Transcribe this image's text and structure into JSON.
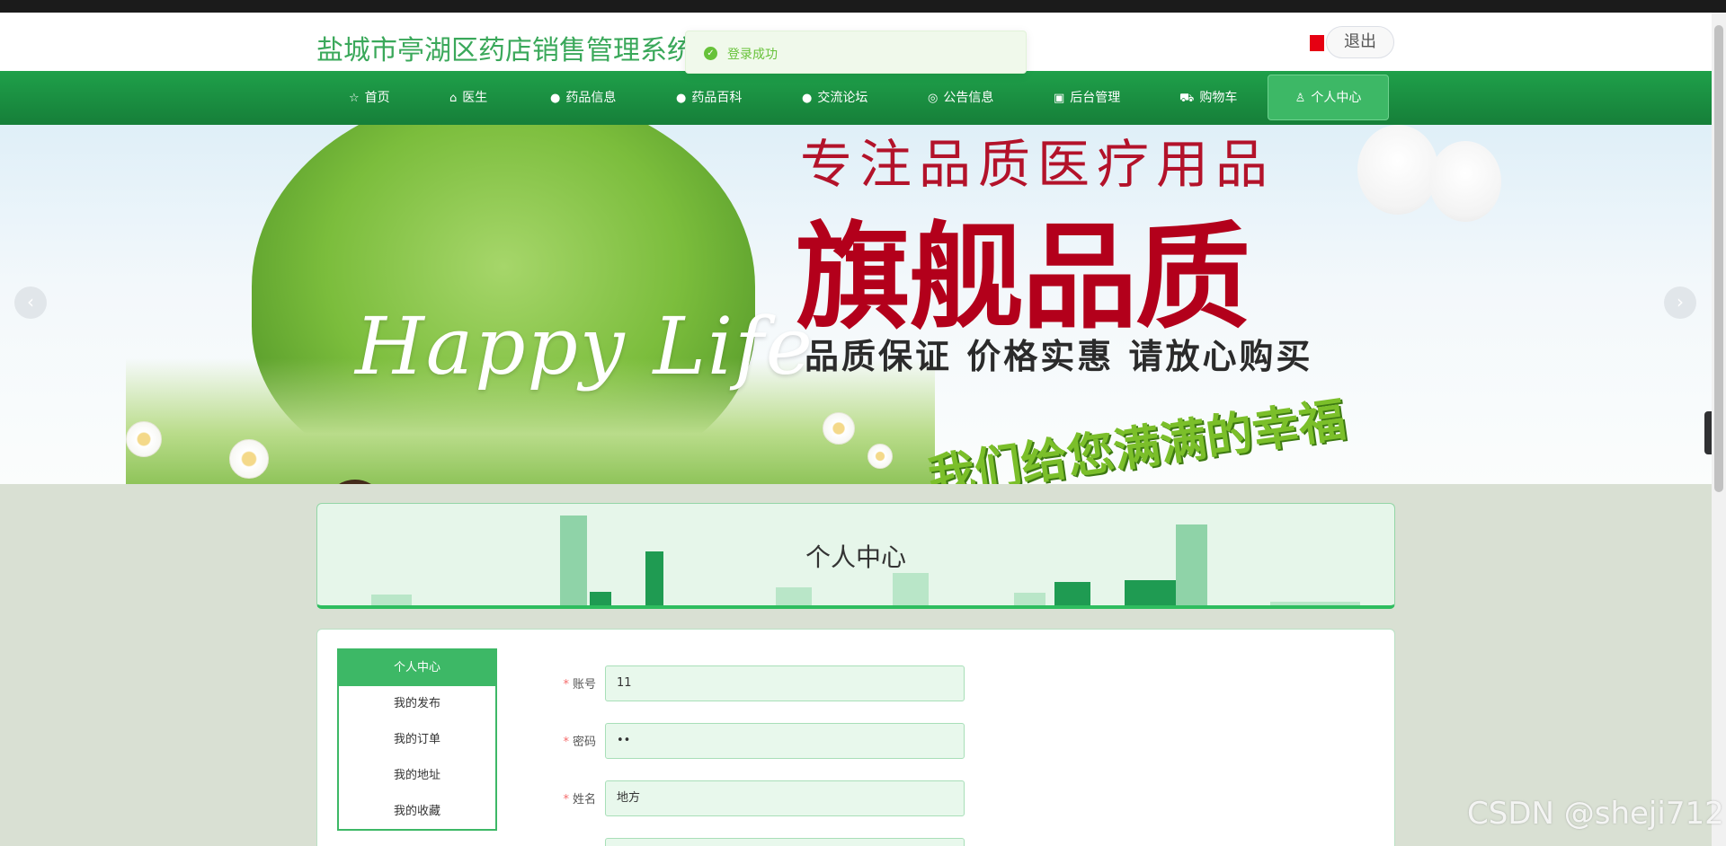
{
  "header": {
    "site_title": "盐城市亭湖区药店销售管理系统",
    "logout_label": "退出",
    "toast_message": "登录成功"
  },
  "nav": {
    "items": [
      {
        "icon": "☆",
        "label": "首页"
      },
      {
        "icon": "⌂",
        "label": "医生"
      },
      {
        "icon": "●",
        "label": "药品信息"
      },
      {
        "icon": "●",
        "label": "药品百科"
      },
      {
        "icon": "●",
        "label": "交流论坛"
      },
      {
        "icon": "◎",
        "label": "公告信息"
      },
      {
        "icon": "▣",
        "label": "后台管理"
      },
      {
        "icon": "⛟",
        "label": "购物车"
      },
      {
        "icon": "♙",
        "label": "个人中心"
      }
    ]
  },
  "banner": {
    "happy_text": "Happy Life",
    "slogan_top": "专注品质医疗用品",
    "slogan_main": "旗舰品质",
    "slogan_sub": "品质保证 价格实惠 请放心购买",
    "slogan_bottom": "我们给您满满的幸福",
    "prev": "‹",
    "next": "›"
  },
  "page": {
    "title": "个人中心"
  },
  "side_menu": {
    "items": [
      "个人中心",
      "我的发布",
      "我的订单",
      "我的地址",
      "我的收藏"
    ]
  },
  "form": {
    "account_label": "账号",
    "account_value": "11",
    "password_label": "密码",
    "password_value": "••",
    "name_label": "姓名",
    "name_value": "地方",
    "required_mark": "*"
  },
  "side_tab": "‹",
  "watermark": "CSDN @sheji712",
  "colors": {
    "brand_green": "#1fa04a",
    "accent_green": "#3db866",
    "title_green": "#3aa85a",
    "slogan_red": "#b3001b"
  }
}
